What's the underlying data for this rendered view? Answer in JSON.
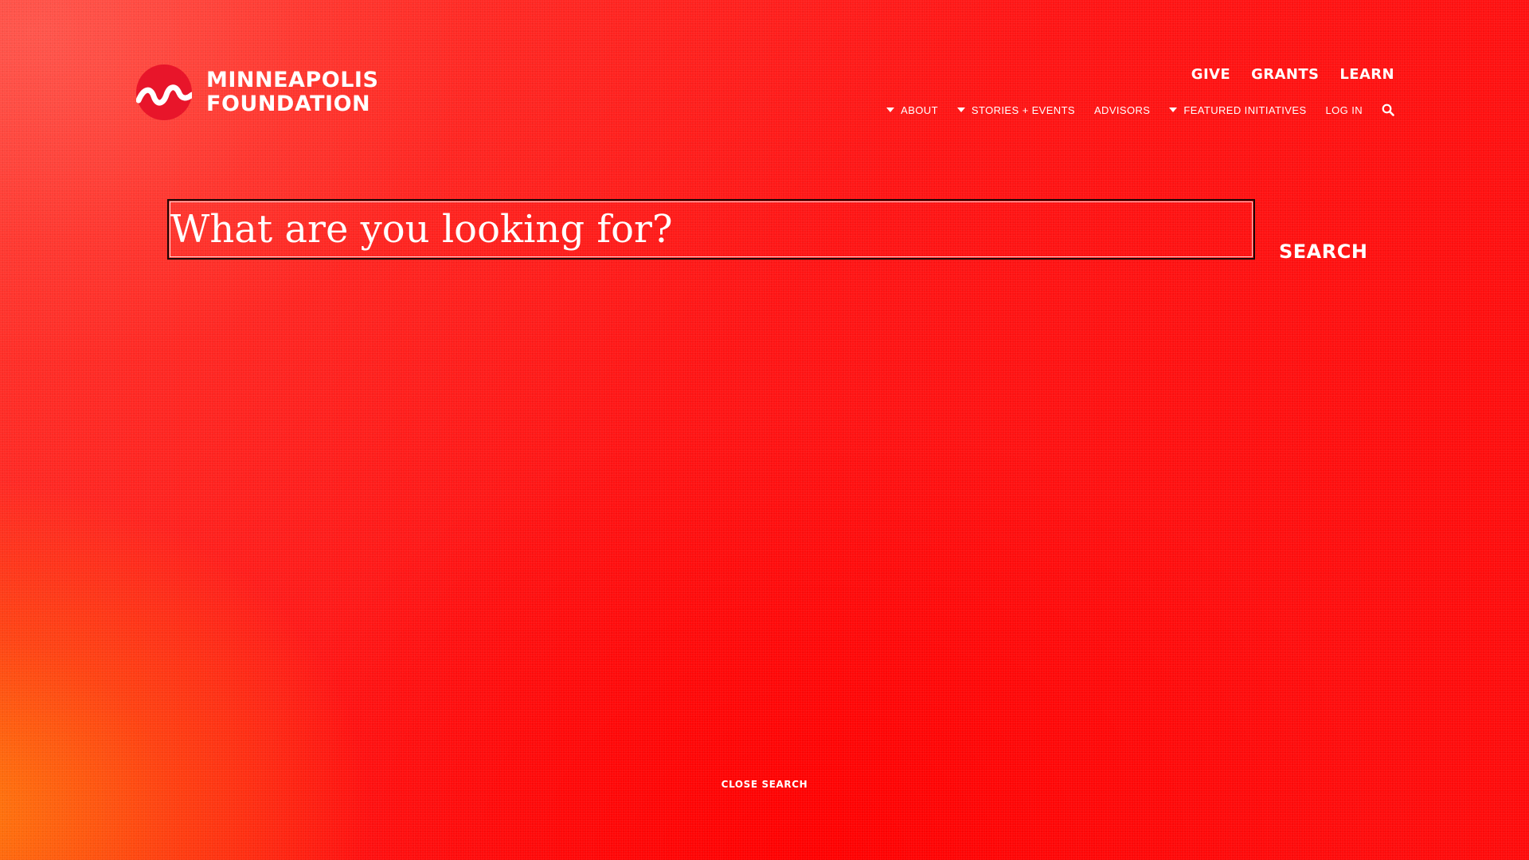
{
  "brand": {
    "line1": "MINNEAPOLIS",
    "line2": "FOUNDATION",
    "logo_icon": "wave-circle-logo",
    "logo_color": "#e8152a"
  },
  "primary_nav": [
    {
      "label": "GIVE"
    },
    {
      "label": "GRANTS"
    },
    {
      "label": "LEARN"
    }
  ],
  "secondary_nav": [
    {
      "label": "ABOUT",
      "has_dropdown": true
    },
    {
      "label": "STORIES + EVENTS",
      "has_dropdown": true
    },
    {
      "label": "ADVISORS",
      "has_dropdown": false
    },
    {
      "label": "FEATURED INITIATIVES",
      "has_dropdown": true
    },
    {
      "label": "LOG IN",
      "has_dropdown": false
    }
  ],
  "search": {
    "placeholder": "What are you looking for?",
    "value": "",
    "button_label": "SEARCH",
    "icon": "search-icon"
  },
  "close_search_label": "CLOSE SEARCH",
  "colors": {
    "background_primary": "#ff1414",
    "background_accent": "#ff820a",
    "text": "#ffffff"
  }
}
